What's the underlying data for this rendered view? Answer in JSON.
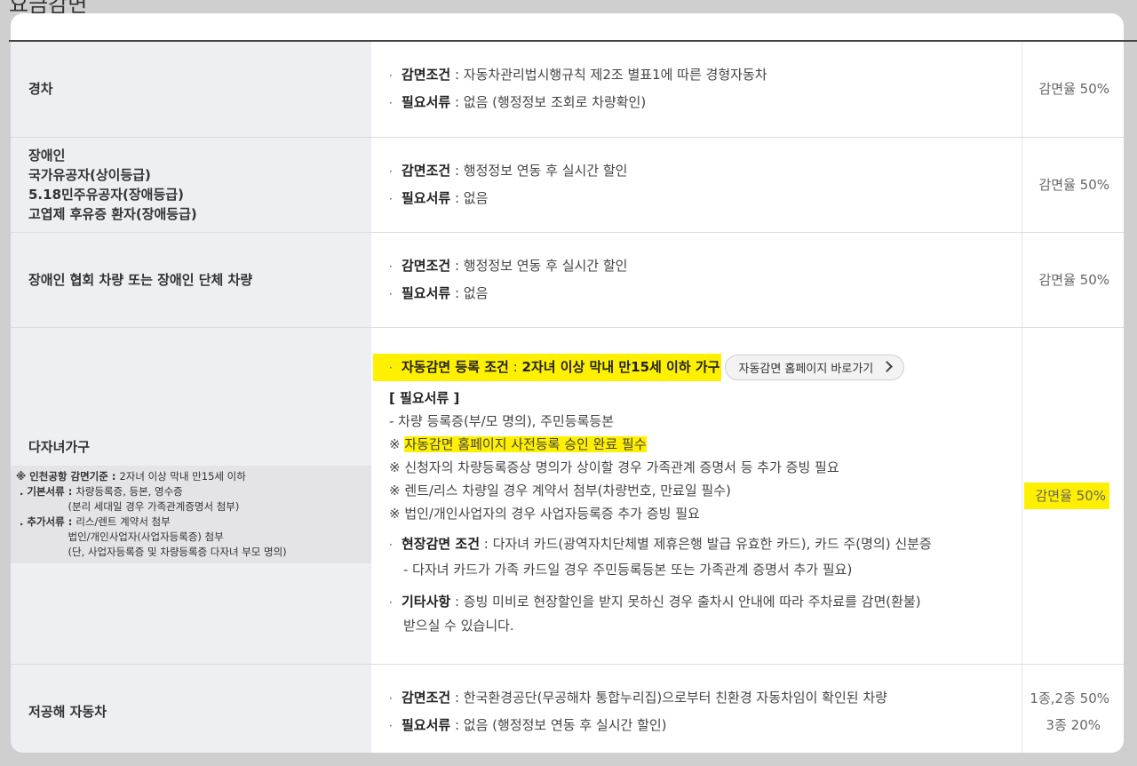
{
  "page": {
    "title": "요금감면"
  },
  "rows": [
    {
      "category": [
        "경차"
      ],
      "condition_label": "감면조건",
      "condition": " : 자동차관리법시행규칙 제2조 별표1에 따른 경형자동차",
      "docs_label": "필요서류",
      "docs": " : 없음 (행정정보 조회로 차량확인)",
      "rate": "감면율 50%"
    },
    {
      "category": [
        "장애인",
        "국가유공자(상이등급)",
        "5.18민주유공자(장애등급)",
        "고엽제 후유증 환자(장애등급)"
      ],
      "condition_label": "감면조건",
      "condition": " : 행정정보 연동 후 실시간 할인",
      "docs_label": "필요서류",
      "docs": " : 없음",
      "rate": "감면율 50%"
    },
    {
      "category": [
        "장애인 협회 차량 또는 장애인 단체 차량"
      ],
      "condition_label": "감면조건",
      "condition": " : 행정정보 연동 후 실시간 할인",
      "docs_label": "필요서류",
      "docs": " : 없음",
      "rate": "감면율 50%"
    }
  ],
  "family": {
    "category": "다자녀가구",
    "notes": {
      "line1_label": "※ 인천공항 감면기준 : ",
      "line1": "2자녀 이상 막내 만15세 이하",
      "line2_label": " . 기본서류 : ",
      "line2": "차량등록증, 등본, 영수증",
      "line3": "(분리 세대일 경우 가족관계증명서 첨부)",
      "line4_label": " . 추가서류 : ",
      "line4": "리스/렌트 계약서 첨부",
      "line5": "법인/개인사업자(사업자등록증) 첨부",
      "line6": "(단, 사업자등록증 및 차량등록증 다자녀 부모 명의)"
    },
    "auto_label": "자동감면 등록 조건",
    "auto_sep": " : ",
    "auto_value": "2자녀 이상 막내 만15세 이하 가구",
    "shortcut_button": "자동감면 홈페이지 바로가기",
    "docs_heading": "[ 필요서류 ]",
    "doc_lines": [
      "- 차량 등록증(부/모 명의), 주민등록등본",
      "※ 신청자의 차량등록증상 명의가 상이할 경우 가족관계 증명서 등 추가 증빙 필요",
      "※ 렌트/리스 차량일 경우 계약서 첨부(차량번호, 만료일 필수)",
      "※ 법인/개인사업자의 경우 사업자등록증 추가 증빙 필요"
    ],
    "doc_highlight_prefix": "※ ",
    "doc_highlight": "자동감면 홈페이지 사전등록 승인 완료 필수",
    "onsite_label": "현장감면 조건",
    "onsite": " : 다자녀 카드(광역자치단체별 제휴은행 발급 유효한 카드), 카드 주(명의) 신분증",
    "onsite_sub": "- 다자녀 카드가 가족 카드일 경우 주민등록등본 또는 가족관계 증명서 추가 필요)",
    "etc_label": "기타사항",
    "etc": " : 증빙 미비로 현장할인을 받지 못하신 경우 출차시 안내에 따라 주차료를 감면(환불)",
    "etc_cont": "받으실 수 있습니다.",
    "rate": "감면율 50%"
  },
  "lowemission": {
    "category": "저공해 자동차",
    "condition_label": "감면조건",
    "condition": " : 한국환경공단(무공해차 통합누리집)으로부터 친환경 자동차임이 확인된 차량",
    "docs_label": "필요서류",
    "docs": " : 없음 (행정정보 연동 후 실시간 할인)",
    "rate1": "1종,2종 50%",
    "rate2": "3종 20%"
  }
}
